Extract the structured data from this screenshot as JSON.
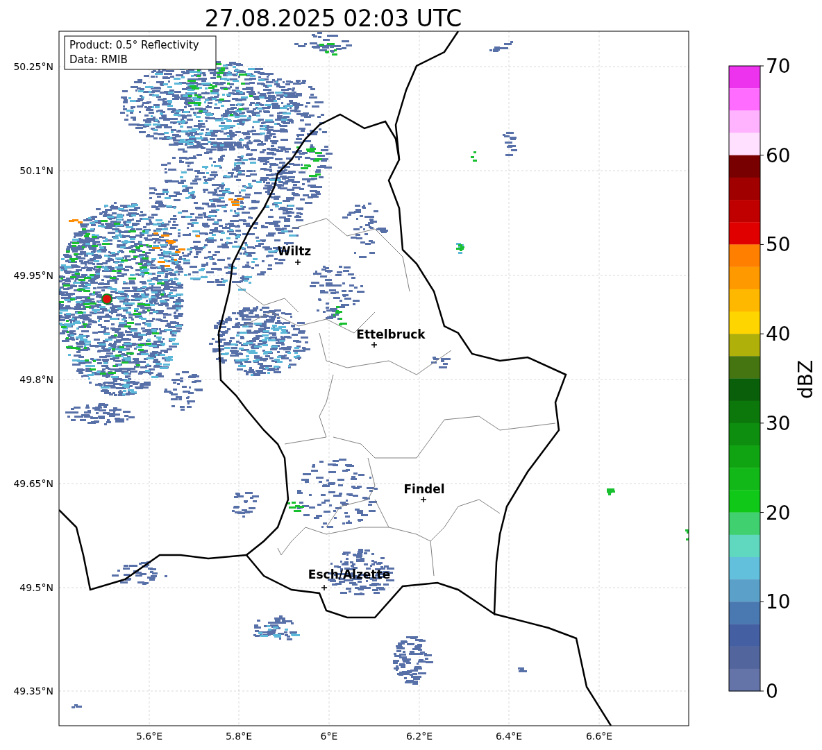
{
  "title": "27.08.2025 02:03 UTC",
  "info_box": {
    "lines": [
      "Product: 0.5° Reflectivity",
      "Data: RMIB"
    ]
  },
  "map": {
    "cities": [
      {
        "name": "Wiltz"
      },
      {
        "name": "Ettelbruck"
      },
      {
        "name": "Findel"
      },
      {
        "name": "Esch/Alzette"
      }
    ],
    "lat_ticks": [
      "50.25°N",
      "50.1°N",
      "49.95°N",
      "49.8°N",
      "49.65°N",
      "49.5°N",
      "49.35°N"
    ],
    "lon_ticks": [
      "5.6°E",
      "5.8°E",
      "6°E",
      "6.2°E",
      "6.4°E",
      "6.6°E"
    ]
  },
  "colorbar": {
    "label": "dBZ",
    "ticks": [
      "70",
      "60",
      "50",
      "40",
      "30",
      "20",
      "10",
      "0"
    ],
    "segments": [
      {
        "color": "#ee33ee"
      },
      {
        "color": "#ff6cff"
      },
      {
        "color": "#ffb3ff"
      },
      {
        "color": "#ffe0ff"
      },
      {
        "color": "#780000"
      },
      {
        "color": "#a00000"
      },
      {
        "color": "#c00000"
      },
      {
        "color": "#e00000"
      },
      {
        "color": "#ff7f00"
      },
      {
        "color": "#ff9900"
      },
      {
        "color": "#ffb800"
      },
      {
        "color": "#ffd500"
      },
      {
        "color": "#b0b00a"
      },
      {
        "color": "#457510"
      },
      {
        "color": "#0a600a"
      },
      {
        "color": "#0c780c"
      },
      {
        "color": "#0e8e0e"
      },
      {
        "color": "#10a412"
      },
      {
        "color": "#12b818"
      },
      {
        "color": "#10c818"
      },
      {
        "color": "#40d070"
      },
      {
        "color": "#60d8c0"
      },
      {
        "color": "#62c0dc"
      },
      {
        "color": "#5aa0c8"
      },
      {
        "color": "#4a78b0"
      },
      {
        "color": "#4460a2"
      },
      {
        "color": "#52659c"
      },
      {
        "color": "#6474a8"
      }
    ]
  }
}
